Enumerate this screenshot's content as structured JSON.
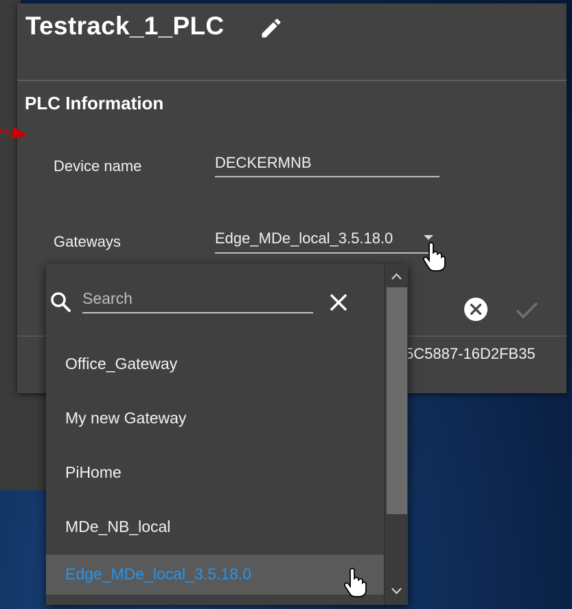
{
  "card": {
    "title": "Testrack_1_PLC",
    "section_title": "PLC Information",
    "device_name_label": "Device name",
    "device_name_value": "DECKERMNB",
    "gateways_label": "Gateways",
    "gateways_value": "Edge_MDe_local_3.5.18.0",
    "id_fragment": "5C5887-16D2FB35"
  },
  "dropdown": {
    "search_placeholder": "Search",
    "options": [
      "Office_Gateway",
      "My new Gateway",
      "PiHome",
      "MDe_NB_local",
      "Edge_MDe_local_3.5.18.0"
    ],
    "selected_index": 4
  },
  "icons": {
    "edit": "pencil-icon",
    "search": "search-icon",
    "clear_search": "close-icon",
    "clear_value": "close-circle-icon",
    "confirm": "check-icon",
    "pointer": "hand-pointer-icon",
    "annotation": "red-arrow-icon"
  },
  "colors": {
    "card_bg": "#424242",
    "dropdown_bg": "#404040",
    "selected_text": "#2196f3",
    "annotation_arrow": "#d00000"
  }
}
